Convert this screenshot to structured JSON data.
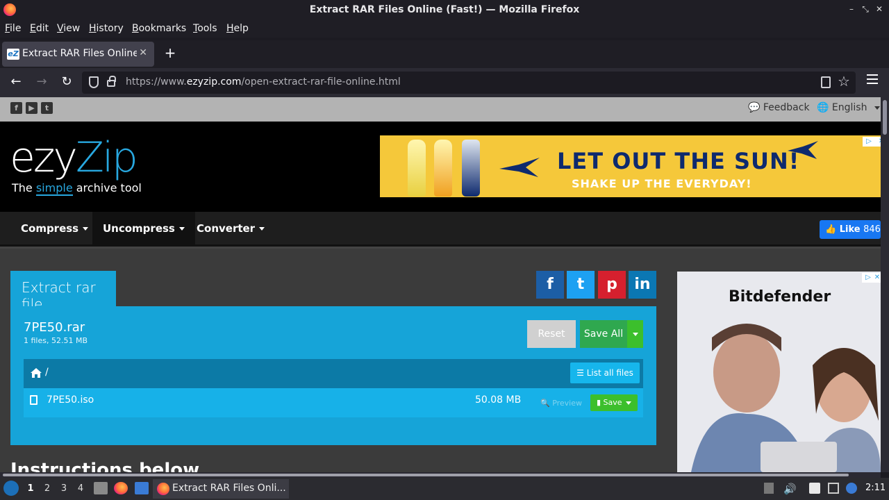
{
  "window": {
    "title": "Extract RAR Files Online (Fast!) — Mozilla Firefox",
    "controls": [
      "–",
      "⤡",
      "✕"
    ]
  },
  "menubar": [
    "File",
    "Edit",
    "View",
    "History",
    "Bookmarks",
    "Tools",
    "Help"
  ],
  "tab": {
    "label": "Extract RAR Files Online",
    "favicon": "eZ"
  },
  "url": {
    "prefix": "https://www.",
    "host": "ezyzip.com",
    "path": "/open-extract-rar-file-online.html"
  },
  "site": {
    "topbar": {
      "feedback": "Feedback",
      "language": "English"
    },
    "logo": {
      "ezy": "ezy",
      "zip": "Zip",
      "tagline_pre": "The ",
      "tagline_simple": "simple",
      "tagline_post": " archive tool"
    },
    "ad_top": {
      "headline_a": "LET OUT ",
      "headline_b": "THE SUN!",
      "subline": "SHAKE UP THE EVERYDAY!"
    },
    "nav": [
      "Compress",
      "Uncompress",
      "Converter"
    ],
    "like": {
      "label": "Like",
      "count": "846"
    },
    "tool": {
      "tab": "Extract rar file",
      "archive_name": "7PE50.rar",
      "archive_meta": "1 files, 52.51 MB",
      "reset": "Reset",
      "save_all": "Save All",
      "path": "/",
      "list_all": "List all files",
      "file": {
        "name": "7PE50.iso",
        "size": "50.08 MB",
        "preview": "Preview",
        "save": "Save"
      }
    },
    "share": [
      "f",
      "t",
      "p",
      "in"
    ],
    "ad_side": {
      "brand": "Bitdefender"
    },
    "instructions": "Instructions below"
  },
  "taskbar": {
    "workspaces": [
      "1",
      "2",
      "3",
      "4"
    ],
    "task": "Extract RAR Files Onli...",
    "clock": "2:11"
  },
  "colors": {
    "accent": "#16a4d8",
    "save_green": "#3cbf2c",
    "nav_dark": "#1e1e1e"
  }
}
